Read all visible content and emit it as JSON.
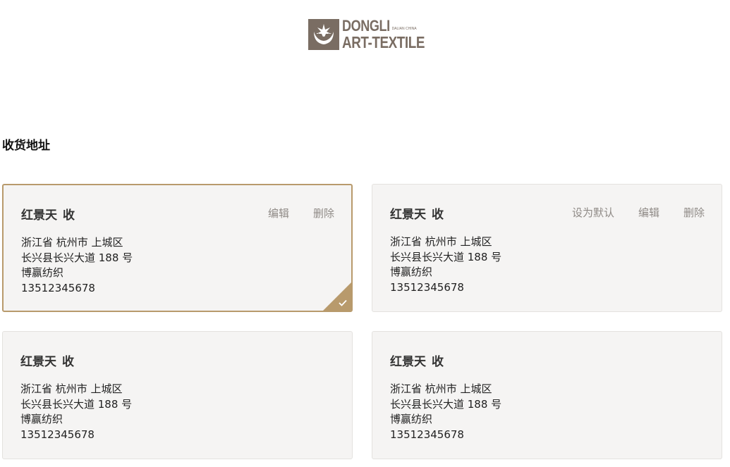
{
  "logo": {
    "word1": "DONGLI",
    "sub": "DALIAN CHINA",
    "word2": "ART-TEXTILE",
    "mark_icon": "dongli-logo-emblem"
  },
  "section_title": "收货地址",
  "colors": {
    "accent": "#b89a6c",
    "card_bg": "#f5f4f3",
    "action_text": "#8f8a86",
    "logo": "#7a6d63"
  },
  "cards": [
    {
      "name": "红景天",
      "suffix": "收",
      "selected": true,
      "actions": {
        "edit": "编辑",
        "delete": "删除"
      },
      "lines": [
        "浙江省 杭州市 上城区",
        "长兴县长兴大道 188 号",
        "博赢纺织",
        "13512345678"
      ]
    },
    {
      "name": "红景天",
      "suffix": "收",
      "selected": false,
      "actions": {
        "set_default": "设为默认",
        "edit": "编辑",
        "delete": "删除"
      },
      "lines": [
        "浙江省 杭州市 上城区",
        "长兴县长兴大道 188 号",
        "博赢纺织",
        "13512345678"
      ]
    },
    {
      "name": "红景天",
      "suffix": "收",
      "selected": false,
      "lines": [
        "浙江省 杭州市 上城区",
        "长兴县长兴大道 188 号",
        "博赢纺织",
        "13512345678"
      ]
    },
    {
      "name": "红景天",
      "suffix": "收",
      "selected": false,
      "lines": [
        "浙江省 杭州市 上城区",
        "长兴县长兴大道 188 号",
        "博赢纺织",
        "13512345678"
      ]
    }
  ]
}
